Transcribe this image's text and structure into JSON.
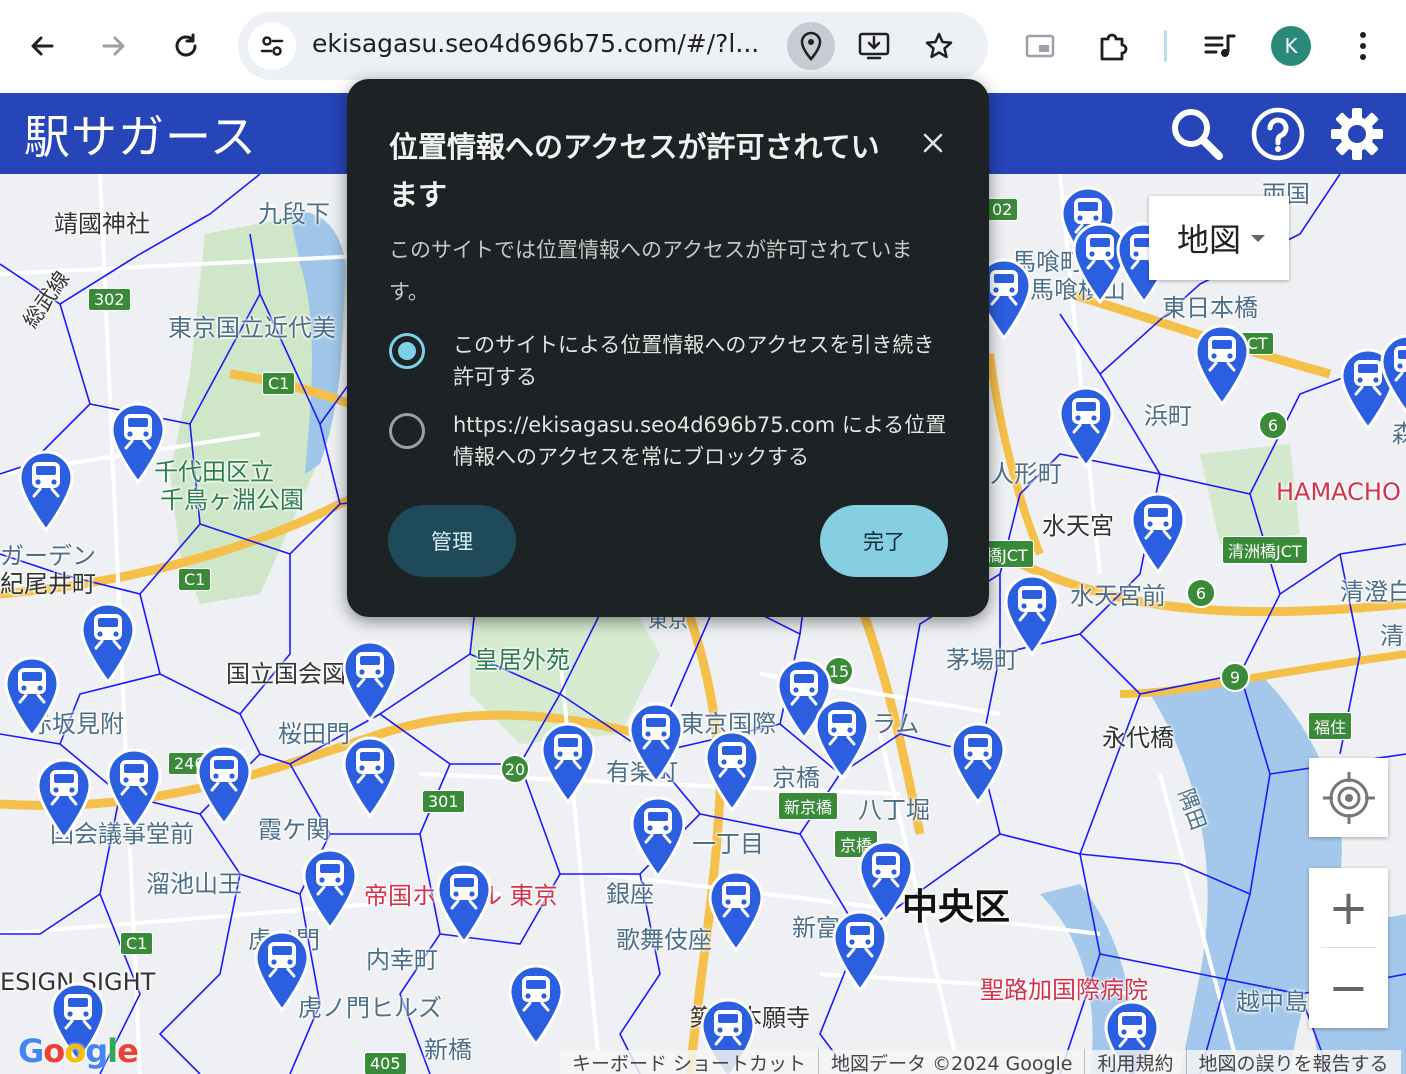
{
  "browser": {
    "url": "ekisagasu.seo4d696b75.com/#/?l...",
    "profile_initial": "K",
    "icons": [
      "back-icon",
      "forward-icon",
      "reload-icon",
      "tune-icon",
      "location-pin-icon",
      "install-app-icon",
      "star-icon",
      "picture-in-picture-icon",
      "extensions-icon",
      "media-control-icon",
      "more-icon"
    ]
  },
  "app": {
    "title": "駅サガース",
    "icons": [
      "search-icon",
      "help-icon",
      "settings-icon"
    ]
  },
  "map": {
    "type_selector": "地図",
    "labels": {
      "yasukuni": "靖國神社",
      "kudanshita": "九段下",
      "sobu": "総武線",
      "kindai": "東京国立近代美",
      "chidorigafuchi_1": "千代田区立",
      "chidorigafuchi_2": "千鳥ヶ淵公園",
      "garden": "ガーデン",
      "kioicho": "紀尾井町",
      "kokkai_toshokan": "国立国会図書館",
      "kokyo_gaien": "皇居外苑",
      "sakuradamon": "桜田門",
      "akasaka_mitsuke": "赤坂見附",
      "kokkaigijidomae": "国会議事堂前",
      "kasumigaseki": "霞ケ関",
      "tameike_sanno": "溜池山王",
      "toranomon": "虎ノ門",
      "toranomon_hills": "虎ノ門ヒルズ",
      "design_sight": "ESIGN SIGHT",
      "uchisaiwaicho": "内幸町",
      "shimbashi": "新橋",
      "imperial_hotel_1": "帝国ホ",
      "imperial_hotel_2": "ル 東京",
      "yurakucho": "有楽町",
      "ginza": "銀座",
      "kabukiza": "歌舞伎座",
      "tokyo_forum": "東京国際",
      "forum_tail": "ラム",
      "kyobashi": "京橋",
      "hatchobori": "八丁堀",
      "itchome": "一丁目",
      "shintomi": "新富",
      "chuo_ku": "中央区",
      "st_lukes": "聖路加国際病院",
      "tsukiji_hongwanji": "築地本願寺",
      "eitaibashi": "永代橋",
      "kayabacho": "茅場町",
      "suitengumae": "水天宮前",
      "suitengu": "水天宮",
      "ningyocho": "人形町",
      "hamacho": "浜町",
      "hamacho_hotel": "HAMACHO",
      "kiyosumi_shirakawa": "清澄白",
      "kiyosumi": "清",
      "bakuro_1": "馬喰町",
      "bakuro_2": "馬喰横山",
      "higashi_nihonbashi": "東日本橋",
      "ryogoku": "両国",
      "tsukishima": "越中島",
      "fukuzumi": "福住",
      "kiyosubashi_jct": "清洲橋JCT",
      "jct": "JCT",
      "hashi_jct": "橋JCT",
      "kyobashi_road": "京橋",
      "shinkyobashi": "新京橋",
      "sumida": "隅田",
      "tokyo_st": "東京",
      "forest": "森"
    },
    "shields": [
      "302",
      "C1",
      "C1",
      "C1",
      "246",
      "301",
      "20",
      "405",
      "02",
      "9",
      "6",
      "6",
      "15"
    ],
    "location_button": "my-location-icon",
    "zoom_in": "+",
    "zoom_out": "−",
    "google_logo": "Google",
    "attribution": [
      "キーボード ショートカット",
      "地図データ ©2024 Google",
      "利用規約",
      "地図の誤りを報告する"
    ]
  },
  "popup": {
    "title": "位置情報へのアクセスが許可されています",
    "description": "このサイトでは位置情報へのアクセスが許可されています。",
    "option_allow": "このサイトによる位置情報へのアクセスを引き続き許可する",
    "option_block": "https://ekisagasu.seo4d696b75.com による位置情報へのアクセスを常にブロックする",
    "selected": "option_allow",
    "manage_label": "管理",
    "done_label": "完了"
  },
  "colors": {
    "header_blue": "#2545b8",
    "voronoi_line": "#1a1aff",
    "pin_blue": "#2b5fe0",
    "popup_bg": "#1d2224",
    "done_button": "#86cfe3",
    "manage_button": "#1f4a59"
  }
}
